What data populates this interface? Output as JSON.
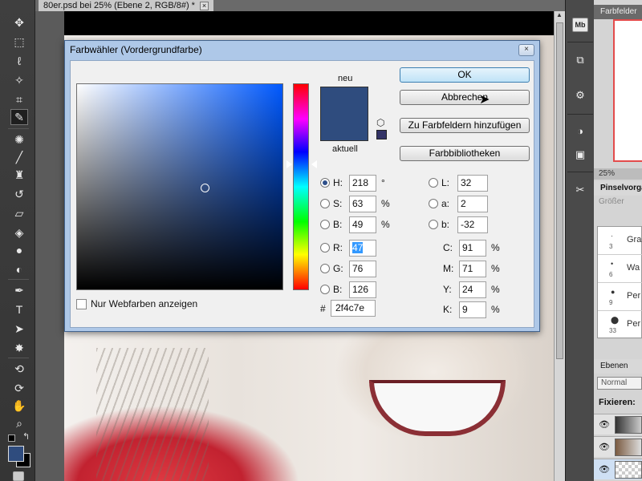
{
  "document": {
    "tab_title": "80er.psd bei 25% (Ebene 2, RGB/8#) *",
    "tab_close": "×"
  },
  "dialog": {
    "title": "Farbwähler (Vordergrundfarbe)",
    "close": "×",
    "label_new": "neu",
    "label_current": "aktuell",
    "new_color": "#2f4c7e",
    "current_color": "#2f4c7e",
    "buttons": {
      "ok": "OK",
      "cancel": "Abbrechen",
      "add_swatches": "Zu Farbfeldern hinzufügen",
      "libraries": "Farbbibliotheken"
    },
    "websafe_label": "Nur Webfarben anzeigen",
    "hsb": {
      "h": {
        "label": "H:",
        "value": "218",
        "unit": "°"
      },
      "s": {
        "label": "S:",
        "value": "63",
        "unit": "%"
      },
      "b": {
        "label": "B:",
        "value": "49",
        "unit": "%"
      }
    },
    "rgb": {
      "r": {
        "label": "R:",
        "value": "47"
      },
      "g": {
        "label": "G:",
        "value": "76"
      },
      "b": {
        "label": "B:",
        "value": "126"
      }
    },
    "lab": {
      "l": {
        "label": "L:",
        "value": "32"
      },
      "a": {
        "label": "a:",
        "value": "2"
      },
      "b": {
        "label": "b:",
        "value": "-32"
      }
    },
    "cmyk": {
      "c": {
        "label": "C:",
        "value": "91",
        "unit": "%"
      },
      "m": {
        "label": "M:",
        "value": "71",
        "unit": "%"
      },
      "y": {
        "label": "Y:",
        "value": "24",
        "unit": "%"
      },
      "k": {
        "label": "K:",
        "value": "9",
        "unit": "%"
      }
    },
    "hex": {
      "label": "#",
      "value": "2f4c7e"
    }
  },
  "panels": {
    "swatches_tab": "Farbfelder",
    "zoom": "25%",
    "brush_tab": "Pinselvorga",
    "brush_size_label": "Größer",
    "brushes": [
      {
        "num": "3",
        "label": "Gra"
      },
      {
        "num": "6",
        "label": "Wa"
      },
      {
        "num": "9",
        "label": "Per"
      },
      {
        "num": "33",
        "label": "Per"
      }
    ],
    "layers_tab": "Ebenen",
    "blend_mode": "Normal",
    "lock_label": "Fixieren:"
  },
  "dock": {
    "mini_bridge": "Mb"
  },
  "colors": {
    "foreground": "#2f4c7e",
    "background": "#000000",
    "accent": "#3c7fb1"
  }
}
